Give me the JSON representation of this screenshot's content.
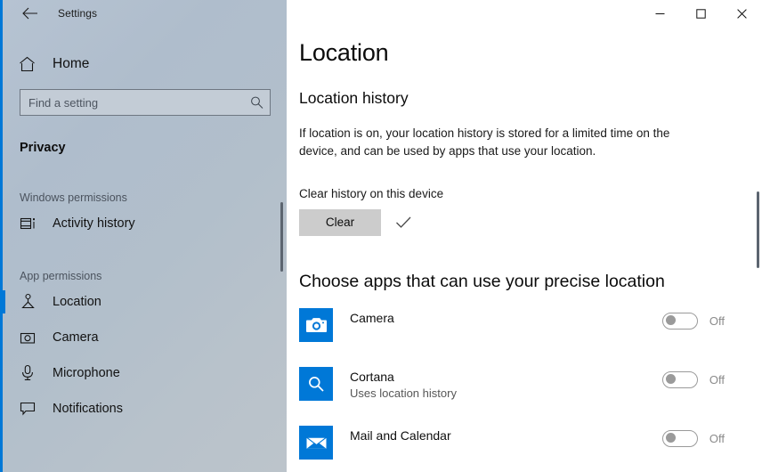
{
  "window": {
    "app_title": "Settings",
    "back_icon": "back-arrow-icon",
    "controls": {
      "minimize": "minimize-icon",
      "maximize": "maximize-icon",
      "close": "close-icon"
    }
  },
  "sidebar": {
    "home_label": "Home",
    "home_icon": "home-icon",
    "search": {
      "placeholder": "Find a setting",
      "value": "",
      "icon": "search-icon"
    },
    "page_name": "Privacy",
    "groups": [
      {
        "label": "Windows permissions",
        "items": [
          {
            "label": "Activity history",
            "icon": "activity-history-icon",
            "selected": false
          }
        ]
      },
      {
        "label": "App permissions",
        "items": [
          {
            "label": "Location",
            "icon": "location-pin-icon",
            "selected": true
          },
          {
            "label": "Camera",
            "icon": "camera-icon",
            "selected": false
          },
          {
            "label": "Microphone",
            "icon": "microphone-icon",
            "selected": false
          },
          {
            "label": "Notifications",
            "icon": "notification-icon",
            "selected": false
          }
        ]
      }
    ]
  },
  "main": {
    "page_title": "Location",
    "history_section": {
      "heading": "Location history",
      "description": "If location is on, your location history is stored for a limited time on the device, and can be used by apps that use your location.",
      "clear_label": "Clear history on this device",
      "clear_button": "Clear",
      "confirm_icon": "checkmark-icon"
    },
    "apps_section": {
      "heading": "Choose apps that can use your precise location",
      "apps": [
        {
          "name": "Camera",
          "subtitle": "",
          "icon": "camera-app-icon",
          "icon_color": "#0078d7",
          "state": "Off",
          "enabled": false
        },
        {
          "name": "Cortana",
          "subtitle": "Uses location history",
          "icon": "cortana-search-icon",
          "icon_color": "#0078d7",
          "state": "Off",
          "enabled": false
        },
        {
          "name": "Mail and Calendar",
          "subtitle": "",
          "icon": "mail-app-icon",
          "icon_color": "#0078d7",
          "state": "Off",
          "enabled": false
        }
      ]
    }
  },
  "colors": {
    "accent": "#0078d7",
    "sidebar_top": "#b6c3d2",
    "button_face": "#cccccc"
  }
}
